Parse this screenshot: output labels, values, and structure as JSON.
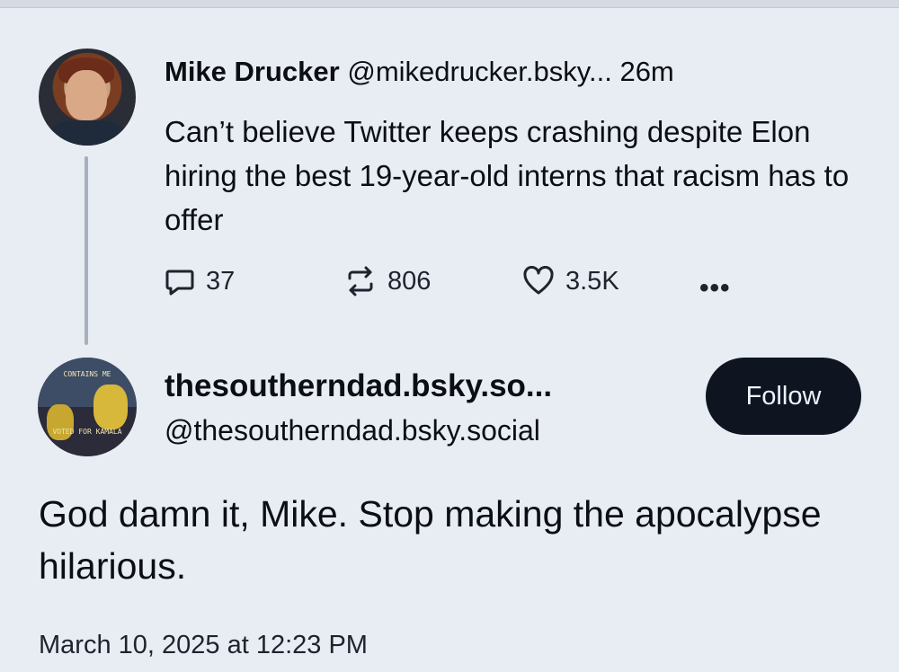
{
  "parent_post": {
    "author_name": "Mike Drucker",
    "author_handle": "@mikedrucker.bsky...",
    "age": "26m",
    "text": "Can’t believe Twitter keeps crashing despite Elon hiring the best 19-year-old interns that racism has to offer",
    "replies": "37",
    "reposts": "806",
    "likes": "3.5K",
    "more": "•••"
  },
  "reply_post": {
    "display_name": "thesoutherndad.bsky.so...",
    "handle": "@thesoutherndad.bsky.social",
    "follow_label": "Follow",
    "text": "God damn it, Mike. Stop making the apocalypse hilarious.",
    "timestamp": "March 10, 2025 at 12:23 PM",
    "avatar_banner_top": "CONTAINS ME",
    "avatar_banner_bottom": "VOTED FOR KAMALA"
  },
  "icons": {
    "reply": "speech-bubble-icon",
    "repost": "repost-arrows-icon",
    "like": "heart-icon",
    "more": "ellipsis-icon"
  },
  "colors": {
    "background": "#e8ecf3",
    "text": "#0b0f14",
    "follow_button": "#0e1420",
    "thread_line": "#a7b0bd"
  }
}
